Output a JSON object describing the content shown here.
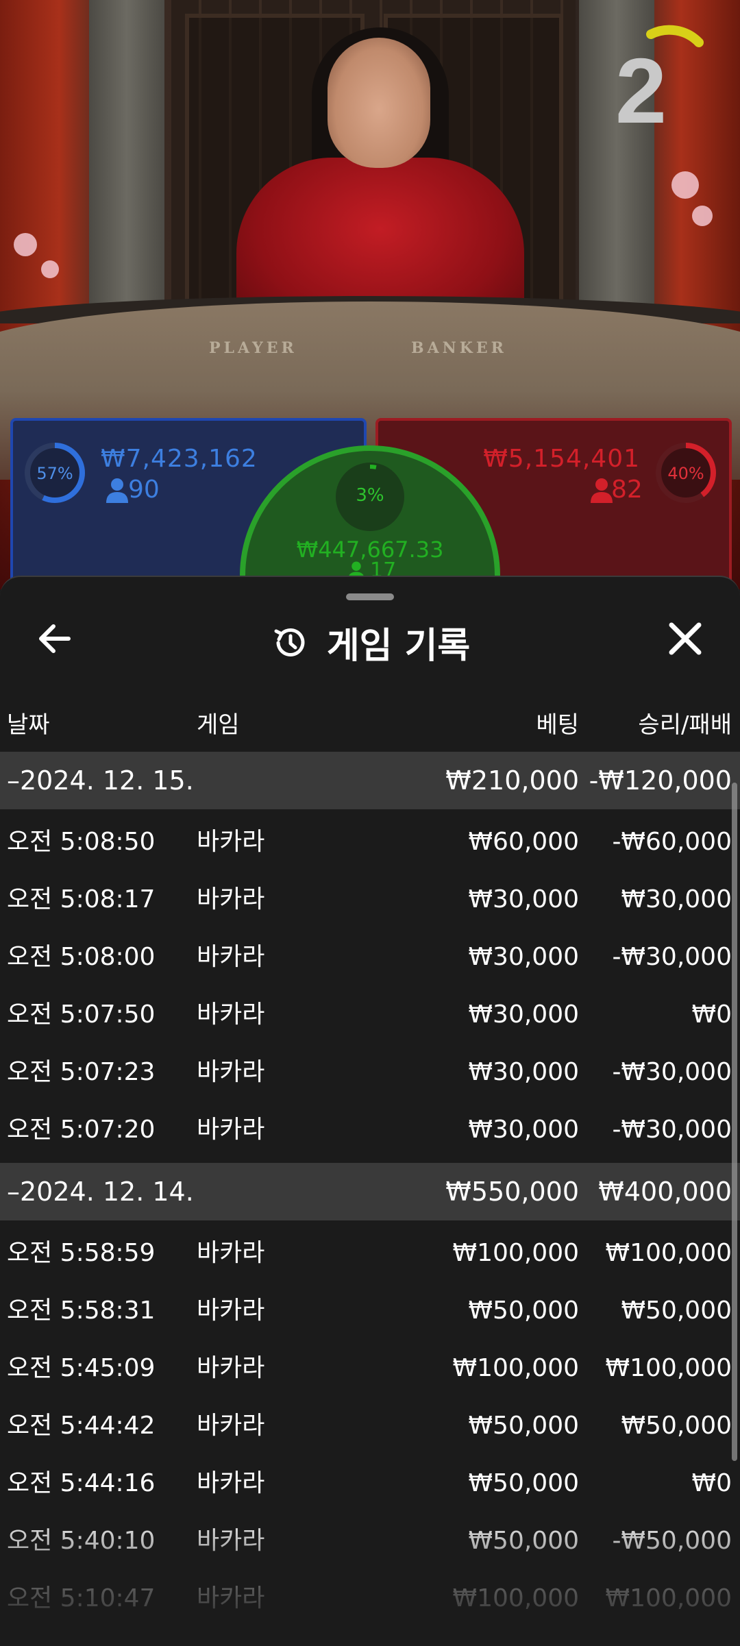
{
  "video": {
    "countdown": "2",
    "felt_player": "PLAYER",
    "felt_banker": "BANKER"
  },
  "bets": {
    "player": {
      "percent": "57%",
      "amount": "₩7,423,162",
      "players": "90",
      "color": "#2f6fdc"
    },
    "banker": {
      "percent": "40%",
      "amount": "₩5,154,401",
      "players": "82",
      "color": "#d3202a"
    },
    "tie": {
      "percent": "3%",
      "amount": "₩447,667.33",
      "players": "17",
      "color": "#22b022"
    }
  },
  "sheet": {
    "title": "게임 기록",
    "icons": {
      "back": "arrow-left-icon",
      "close": "close-icon",
      "title": "history-icon"
    },
    "columns": {
      "date": "날짜",
      "game": "게임",
      "bet": "베팅",
      "result": "승리/패배"
    },
    "groups": [
      {
        "date": "–2024. 12. 15.",
        "bet": "₩210,000",
        "result": "-₩120,000",
        "rows": [
          {
            "time": "오전 5:08:50",
            "game": "바카라",
            "bet": "₩60,000",
            "result": "-₩60,000"
          },
          {
            "time": "오전 5:08:17",
            "game": "바카라",
            "bet": "₩30,000",
            "result": "₩30,000"
          },
          {
            "time": "오전 5:08:00",
            "game": "바카라",
            "bet": "₩30,000",
            "result": "-₩30,000"
          },
          {
            "time": "오전 5:07:50",
            "game": "바카라",
            "bet": "₩30,000",
            "result": "₩0"
          },
          {
            "time": "오전 5:07:23",
            "game": "바카라",
            "bet": "₩30,000",
            "result": "-₩30,000"
          },
          {
            "time": "오전 5:07:20",
            "game": "바카라",
            "bet": "₩30,000",
            "result": "-₩30,000"
          }
        ]
      },
      {
        "date": "–2024. 12. 14.",
        "bet": "₩550,000",
        "result": "₩400,000",
        "rows": [
          {
            "time": "오전 5:58:59",
            "game": "바카라",
            "bet": "₩100,000",
            "result": "₩100,000"
          },
          {
            "time": "오전 5:58:31",
            "game": "바카라",
            "bet": "₩50,000",
            "result": "₩50,000"
          },
          {
            "time": "오전 5:45:09",
            "game": "바카라",
            "bet": "₩100,000",
            "result": "₩100,000"
          },
          {
            "time": "오전 5:44:42",
            "game": "바카라",
            "bet": "₩50,000",
            "result": "₩50,000"
          },
          {
            "time": "오전 5:44:16",
            "game": "바카라",
            "bet": "₩50,000",
            "result": "₩0"
          },
          {
            "time": "오전 5:40:10",
            "game": "바카라",
            "bet": "₩50,000",
            "result": "-₩50,000"
          },
          {
            "time": "오전 5:10:47",
            "game": "바카라",
            "bet": "₩100,000",
            "result": "₩100,000"
          }
        ]
      }
    ]
  }
}
